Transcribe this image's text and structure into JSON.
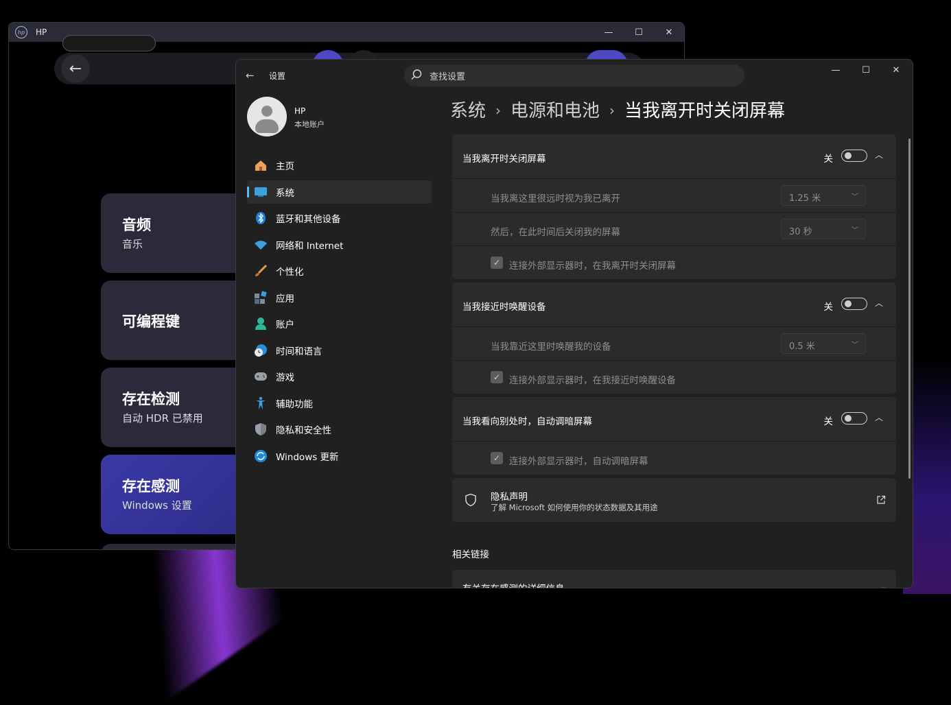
{
  "hp_window": {
    "title": "HP",
    "cards": [
      {
        "title": "音频",
        "subtitle": "音乐"
      },
      {
        "title": "可编程键",
        "subtitle": ""
      },
      {
        "title": "存在检测",
        "subtitle": "自动 HDR 已禁用"
      },
      {
        "title": "存在感测",
        "subtitle": "Windows 设置"
      }
    ]
  },
  "settings": {
    "window_title": "设置",
    "search_placeholder": "查找设置",
    "user": {
      "name": "HP",
      "account_type": "本地账户"
    },
    "nav": [
      {
        "label": "主页",
        "icon": "home-icon"
      },
      {
        "label": "系统",
        "icon": "system-icon",
        "active": true
      },
      {
        "label": "蓝牙和其他设备",
        "icon": "bluetooth-icon"
      },
      {
        "label": "网络和 Internet",
        "icon": "network-icon"
      },
      {
        "label": "个性化",
        "icon": "brush-icon"
      },
      {
        "label": "应用",
        "icon": "apps-icon"
      },
      {
        "label": "账户",
        "icon": "accounts-icon"
      },
      {
        "label": "时间和语言",
        "icon": "time-language-icon"
      },
      {
        "label": "游戏",
        "icon": "gaming-icon"
      },
      {
        "label": "辅助功能",
        "icon": "accessibility-icon"
      },
      {
        "label": "隐私和安全性",
        "icon": "privacy-shield-icon"
      },
      {
        "label": "Windows 更新",
        "icon": "windows-update-icon"
      }
    ],
    "breadcrumb": [
      "系统",
      "电源和电池",
      "当我离开时关闭屏幕"
    ],
    "sections": {
      "leave": {
        "title": "当我离开时关闭屏幕",
        "toggle_label": "关",
        "distance_label": "当我离这里很远时视为我已离开",
        "distance_value": "1.25 米",
        "timeout_label": "然后，在此时间后关闭我的屏幕",
        "timeout_value": "30 秒",
        "external_checkbox": "连接外部显示器时，在我离开时关闭屏幕"
      },
      "wake": {
        "title": "当我接近时唤醒设备",
        "toggle_label": "关",
        "distance_label": "当我靠近这里时唤醒我的设备",
        "distance_value": "0.5 米",
        "external_checkbox": "连接外部显示器时，在我接近时唤醒设备"
      },
      "dim": {
        "title": "当我看向别处时，自动调暗屏幕",
        "toggle_label": "关",
        "external_checkbox": "连接外部显示器时，自动调暗屏幕"
      }
    },
    "privacy": {
      "title": "隐私声明",
      "subtitle": "了解 Microsoft 如何使用你的状态数据及其用途"
    },
    "related_links": {
      "heading": "相关链接",
      "first_link": "有关存在感测的详细信息"
    },
    "colors": {
      "accent": "#4cc2ff",
      "window_bg": "#202020",
      "card_bg": "#2b2b2b"
    }
  }
}
